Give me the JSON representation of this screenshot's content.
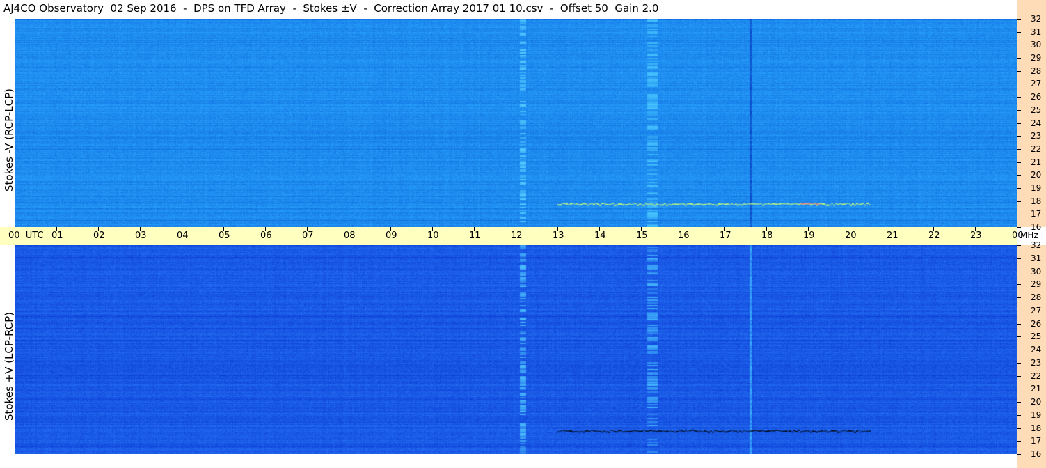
{
  "title": "AJ4CO Observatory  02 Sep 2016  -  DPS on TFD Array  -  Stokes ±V  -  Correction Array 2017 01 10.csv  -  Offset 50  Gain 2.0",
  "chart_data": [
    {
      "type": "heatmap",
      "panel": "top",
      "ylabel": "Stokes -V (RCP-LCP)",
      "x_unit": "UTC",
      "x_ticks": [
        "00",
        "01",
        "02",
        "03",
        "04",
        "05",
        "06",
        "07",
        "08",
        "09",
        "10",
        "11",
        "12",
        "13",
        "14",
        "15",
        "16",
        "17",
        "18",
        "19",
        "20",
        "21",
        "22",
        "23",
        "00"
      ],
      "xlim": [
        0,
        24
      ],
      "y_unit": "MHz",
      "y_ticks": [
        16,
        17,
        18,
        19,
        20,
        21,
        22,
        23,
        24,
        25,
        26,
        27,
        28,
        29,
        30,
        31,
        32
      ],
      "ylim": [
        16,
        32
      ],
      "base_color": "#1e8cf0",
      "features": [
        {
          "kind": "vertical_band",
          "t_start": 12.1,
          "t_end": 12.25,
          "color": "#5ad2ff"
        },
        {
          "kind": "vertical_band",
          "t_start": 15.15,
          "t_end": 15.4,
          "color": "#4ac8ff"
        },
        {
          "kind": "vertical_line",
          "t": 17.6,
          "color": "#0a46c8"
        },
        {
          "kind": "horizontal_streak",
          "t_start": 13.0,
          "t_end": 20.5,
          "f": 17.8,
          "color": "#c8ff78"
        },
        {
          "kind": "horizontal_streak",
          "t_start": 18.8,
          "t_end": 19.3,
          "f": 17.85,
          "color": "#ff7878"
        }
      ]
    },
    {
      "type": "heatmap",
      "panel": "bottom",
      "ylabel": "Stokes +V (LCP-RCP)",
      "x_unit": "UTC",
      "x_ticks": [
        "00",
        "01",
        "02",
        "03",
        "04",
        "05",
        "06",
        "07",
        "08",
        "09",
        "10",
        "11",
        "12",
        "13",
        "14",
        "15",
        "16",
        "17",
        "18",
        "19",
        "20",
        "21",
        "22",
        "23",
        "00"
      ],
      "xlim": [
        0,
        24
      ],
      "y_unit": "MHz",
      "y_ticks": [
        16,
        17,
        18,
        19,
        20,
        21,
        22,
        23,
        24,
        25,
        26,
        27,
        28,
        29,
        30,
        31,
        32
      ],
      "ylim": [
        16,
        32
      ],
      "base_color": "#1a5ae6",
      "features": [
        {
          "kind": "vertical_band",
          "t_start": 12.1,
          "t_end": 12.25,
          "color": "#50c8ff"
        },
        {
          "kind": "vertical_band",
          "t_start": 15.15,
          "t_end": 15.4,
          "color": "#46beff"
        },
        {
          "kind": "vertical_line",
          "t": 17.6,
          "color": "#3cb4ff"
        },
        {
          "kind": "horizontal_streak",
          "t_start": 13.0,
          "t_end": 20.5,
          "f": 17.8,
          "color": "#000814"
        }
      ]
    }
  ],
  "time_axis": {
    "labels": [
      "00  UTC",
      "01",
      "02",
      "03",
      "04",
      "05",
      "06",
      "07",
      "08",
      "09",
      "10",
      "11",
      "12",
      "13",
      "14",
      "15",
      "16",
      "17",
      "18",
      "19",
      "20",
      "21",
      "22",
      "23",
      "00"
    ]
  },
  "freq_unit": "MHz"
}
